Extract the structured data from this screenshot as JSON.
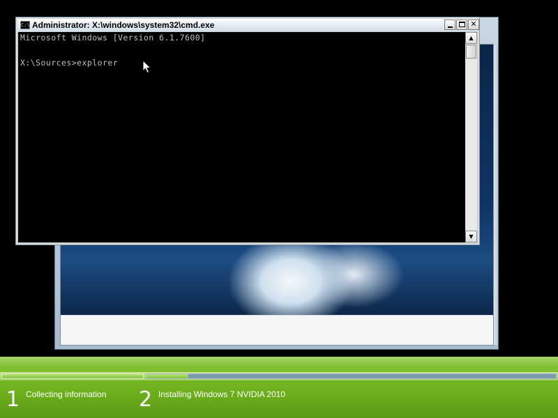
{
  "cmd_window": {
    "title": "Administrator: X:\\windows\\system32\\cmd.exe",
    "app_icon_text": "C:\\.",
    "console_lines": [
      "Microsoft Windows [Version 6.1.7600]",
      "X:\\Sources>explorer"
    ],
    "buttons": {
      "minimize": "minimize-icon",
      "maximize": "maximize-icon",
      "close_label": "✕"
    },
    "scrollbar": {
      "up_arrow": "▲",
      "down_arrow": "▼"
    }
  },
  "setup_progress": {
    "steps": [
      {
        "number": "1",
        "label": "Collecting information"
      },
      {
        "number": "2",
        "label": "Installing Windows 7 NVIDIA 2010"
      }
    ],
    "step2_progress_fraction": 0.1
  },
  "colors": {
    "console_background": "#000000",
    "console_text": "#c0c0c0",
    "progress_green": "#6cae1c"
  }
}
